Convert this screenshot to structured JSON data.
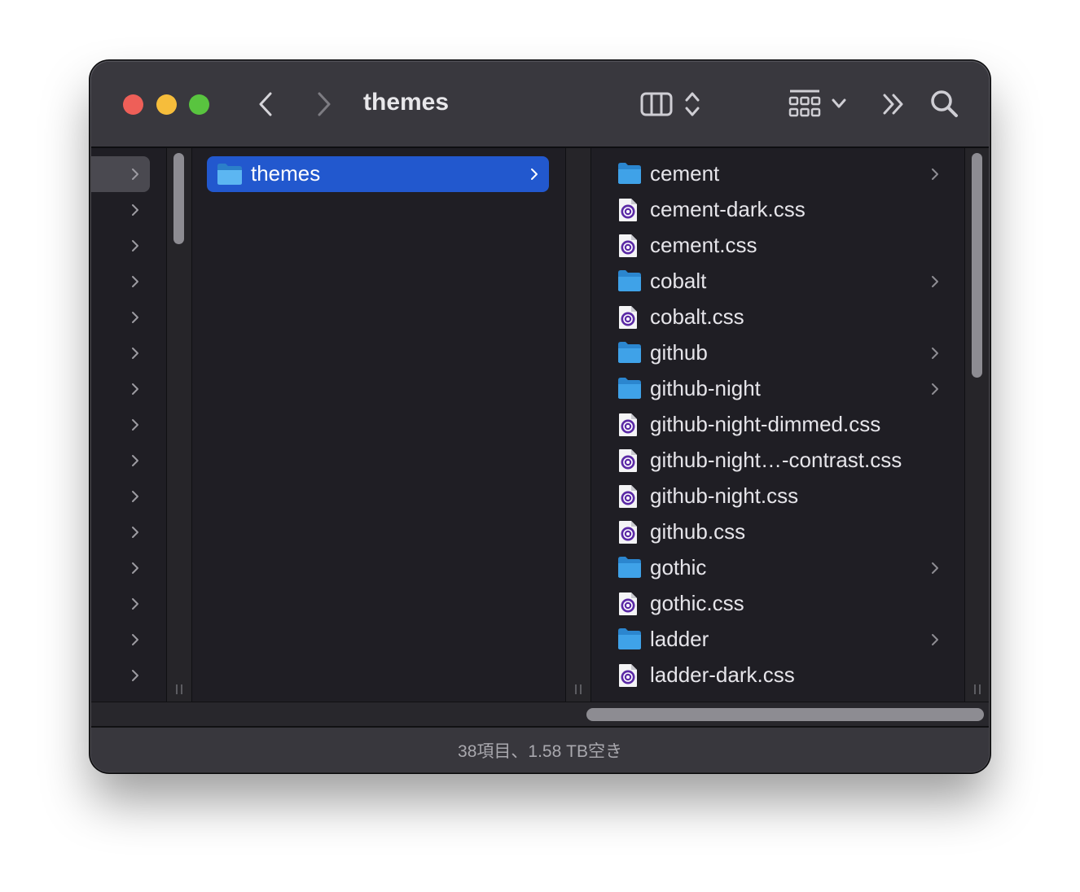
{
  "window": {
    "title": "themes",
    "status_text": "38項目、1.58 TB空き"
  },
  "toolbar": {
    "back_icon": "chevron-left-icon",
    "forward_icon": "chevron-right-icon",
    "view_icon": "column-view-icon",
    "group_icon": "group-grid-icon",
    "more_icon": "double-chevron-icon",
    "search_icon": "search-icon"
  },
  "columns": {
    "left_col_row_count": 15,
    "middle": {
      "selected_item": {
        "label": "themes",
        "type": "folder"
      }
    },
    "right": {
      "items": [
        {
          "label": "cement",
          "type": "folder"
        },
        {
          "label": "cement-dark.css",
          "type": "css"
        },
        {
          "label": "cement.css",
          "type": "css"
        },
        {
          "label": "cobalt",
          "type": "folder"
        },
        {
          "label": "cobalt.css",
          "type": "css"
        },
        {
          "label": "github",
          "type": "folder"
        },
        {
          "label": "github-night",
          "type": "folder"
        },
        {
          "label": "github-night-dimmed.css",
          "type": "css"
        },
        {
          "label": "github-night…-contrast.css",
          "type": "css"
        },
        {
          "label": "github-night.css",
          "type": "css"
        },
        {
          "label": "github.css",
          "type": "css"
        },
        {
          "label": "gothic",
          "type": "folder"
        },
        {
          "label": "gothic.css",
          "type": "css"
        },
        {
          "label": "ladder",
          "type": "folder"
        },
        {
          "label": "ladder-dark.css",
          "type": "css"
        }
      ]
    }
  },
  "colors": {
    "selection": "#2258ce",
    "folder": "#3fa2e8",
    "css_icon": "#5b2aa6"
  }
}
